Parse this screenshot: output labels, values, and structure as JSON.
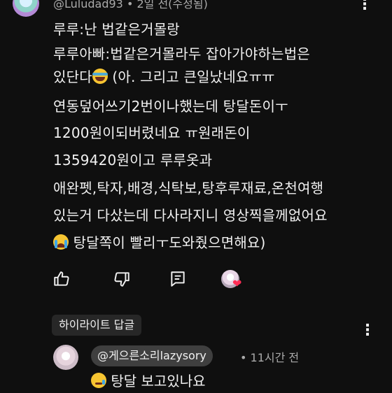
{
  "comment": {
    "author": "@Luludad93",
    "time": "2일 전(수정됨)",
    "lines": [
      "루루:난 법같은거몰랑",
      "루루아빠:법같은거몰라두 잡아가야하는법은",
      "있단다",
      "(아. 그리고 큰일났네요ㅠㅠ",
      "연동덮어쓰기2번이나했는데 탕달돈이ㅜ",
      "1200원이되버렸네요 ㅠ원래돈이",
      "1359420원이고 루루옷과",
      "애완펫,탁자,배경,식탁보,탕후루재료,온천여행",
      "있는거 다샀는데 다사라지니 영상찍을께없어요",
      "탕달쪽이 빨리ㅜ도와줬으면해요)"
    ]
  },
  "actions": {
    "like_icon": "thumb-up-icon",
    "dislike_icon": "thumb-down-icon",
    "reply_icon": "reply-icon",
    "creator_heart_icon": "heart-icon"
  },
  "highlight_label": "하이라이트 답글",
  "reply": {
    "author": "@게으른소리lazysory",
    "time": "• 11시간 전",
    "text": "탕달 보고있나요"
  },
  "colors": {
    "background": "#0f0f0f",
    "text": "#f1f1f1",
    "meta": "#aaaaaa",
    "heart": "#ff2d55",
    "chip": "#272727"
  }
}
